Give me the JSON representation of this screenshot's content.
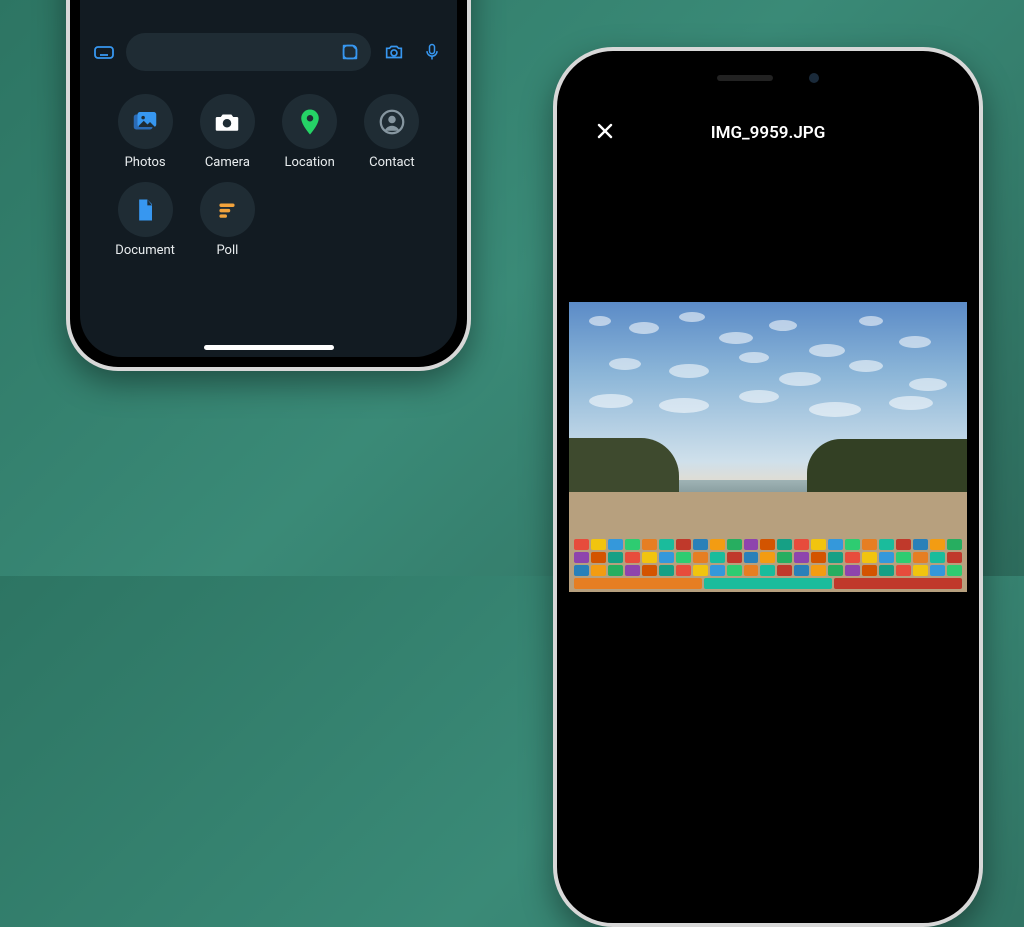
{
  "left_phone": {
    "chat_input": {
      "placeholder": ""
    },
    "attach": {
      "items": [
        {
          "label": "Photos",
          "icon": "photos-icon",
          "color": "#3797f0"
        },
        {
          "label": "Camera",
          "icon": "camera-icon",
          "color": "#ffffff"
        },
        {
          "label": "Location",
          "icon": "location-icon",
          "color": "#25d366"
        },
        {
          "label": "Contact",
          "icon": "contact-icon",
          "color": "#8696a0"
        },
        {
          "label": "Document",
          "icon": "document-icon",
          "color": "#3797f0"
        },
        {
          "label": "Poll",
          "icon": "poll-icon",
          "color": "#f2a33c"
        }
      ]
    }
  },
  "right_phone": {
    "preview": {
      "title": "IMG_9959.JPG"
    }
  }
}
